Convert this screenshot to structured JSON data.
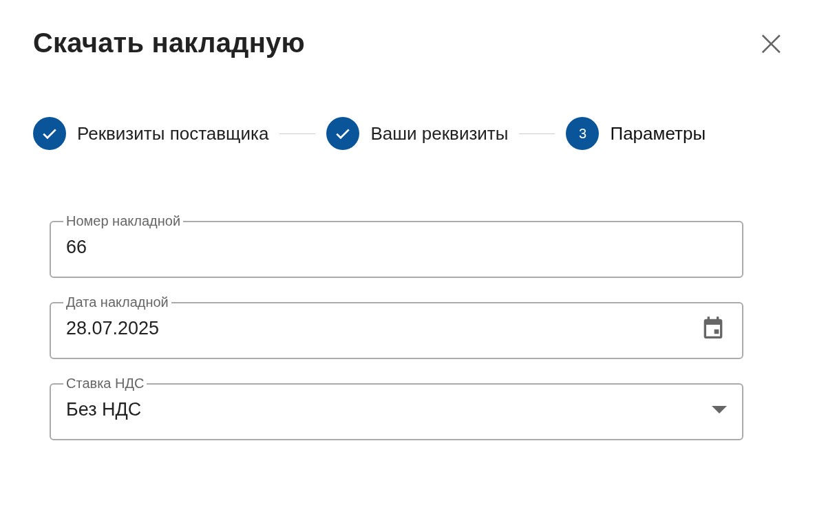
{
  "dialog": {
    "title": "Скачать накладную",
    "close": "×"
  },
  "steps": [
    {
      "label": "Реквизиты поставщика",
      "completed": true,
      "selected": false
    },
    {
      "label": "Ваши реквизиты",
      "completed": true,
      "selected": false
    },
    {
      "label": "Параметры",
      "completed": false,
      "selected": true,
      "number": "3"
    }
  ],
  "fields": [
    {
      "kind": "text",
      "label": "Номер накладной",
      "value": "66"
    },
    {
      "kind": "date",
      "label": "Дата накладной",
      "value": "28.07.2025"
    },
    {
      "kind": "select",
      "label": "Ставка НДС",
      "value": "Без НДС"
    }
  ]
}
